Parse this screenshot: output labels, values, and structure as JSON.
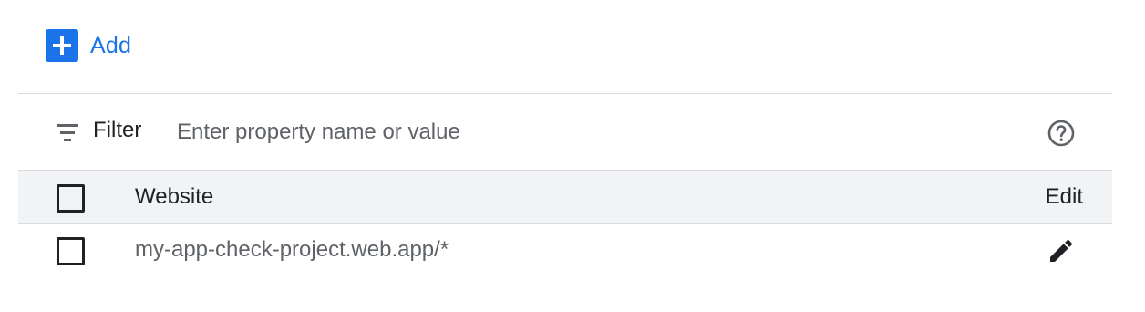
{
  "toolbar": {
    "add_label": "Add",
    "add_icon": "plus-icon",
    "accent_color": "#1a73e8"
  },
  "filter": {
    "label": "Filter",
    "placeholder": "Enter property name or value",
    "value": "",
    "filter_icon": "filter-list-icon",
    "help_icon": "help-outline-icon"
  },
  "table": {
    "columns": [
      "Website",
      "Edit"
    ],
    "rows": [
      {
        "website": "my-app-check-project.web.app/*",
        "edit_icon": "pencil-icon",
        "selected": false
      }
    ],
    "header_selected": false
  }
}
